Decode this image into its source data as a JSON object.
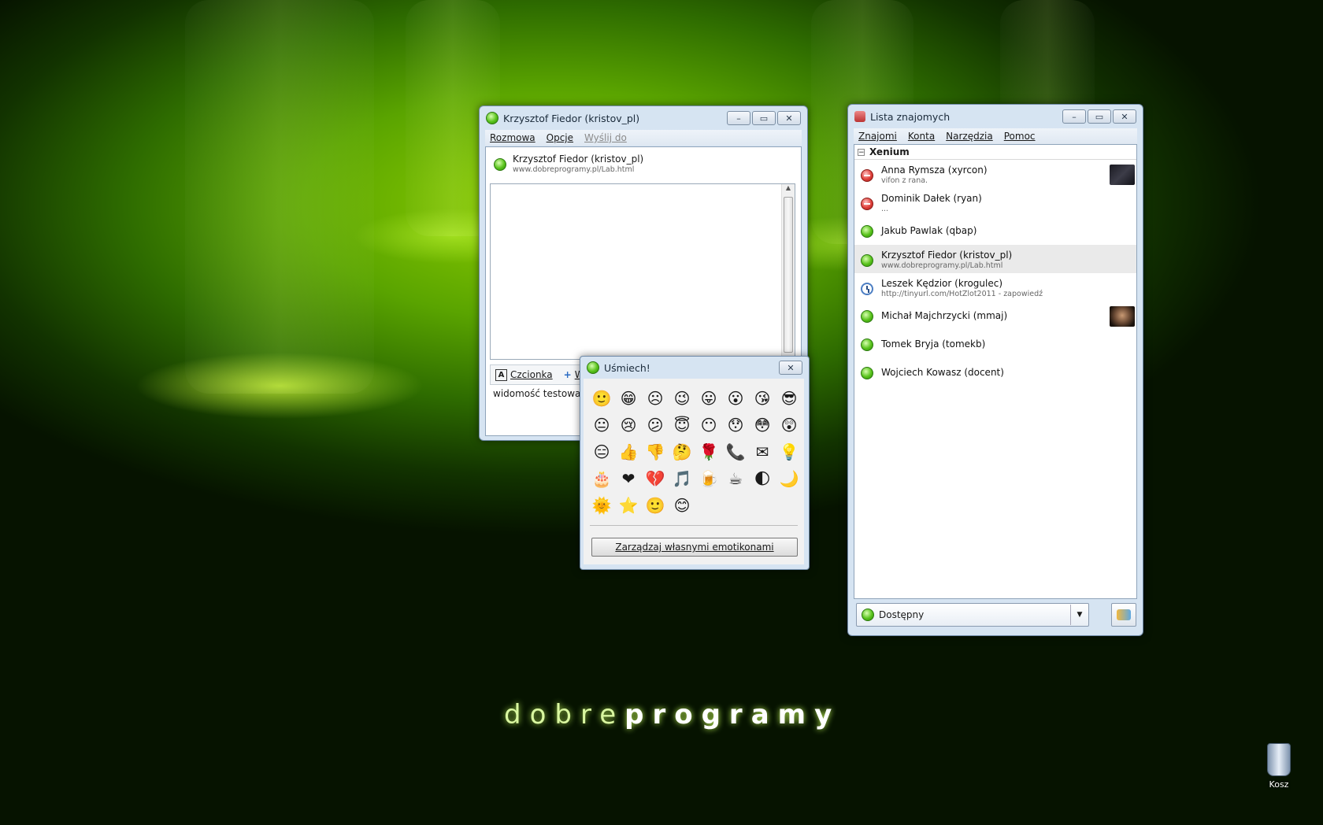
{
  "desktop": {
    "brand_light": "dobre",
    "brand_bold": "programy",
    "trash_label": "Kosz"
  },
  "chat": {
    "title": "Krzysztof Fiedor (kristov_pl)",
    "menu": [
      "Rozmowa",
      "Opcje",
      "Wyślij do"
    ],
    "contact_name": "Krzysztof Fiedor (kristov_pl)",
    "contact_desc": "www.dobreprogramy.pl/Lab.html",
    "font_button": "Czcionka",
    "insert_button": "W",
    "message_input": "widomość testowa :)"
  },
  "emoticons": {
    "title": "Uśmiech!",
    "manage_button": "Zarządzaj własnymi emotikonami",
    "items": [
      "🙂",
      "😁",
      "☹",
      "😉",
      "😛",
      "😮",
      "😘",
      "😎",
      "😐",
      "😢",
      "😕",
      "😇",
      "😶",
      "😯",
      "😳",
      "😲",
      "😑",
      "👍",
      "👎",
      "🤔",
      "🌹",
      "📞",
      "✉",
      "💡",
      "🎂",
      "❤",
      "💔",
      "🎵",
      "🍺",
      "☕",
      "🌓",
      "🌙",
      "🌞",
      "⭐",
      "🙂",
      "😊"
    ]
  },
  "contacts": {
    "title": "Lista znajomych",
    "menu": [
      "Znajomi",
      "Konta",
      "Narzędzia",
      "Pomoc"
    ],
    "group": "Xenium",
    "items": [
      {
        "name": "Anna Rymsza (xyrcon)",
        "desc": "vifon z rana.",
        "status": "red",
        "avatar": "dark"
      },
      {
        "name": "Dominik Dałek (ryan)",
        "desc": "...",
        "status": "red",
        "avatar": ""
      },
      {
        "name": "Jakub Pawlak (qbap)",
        "desc": "",
        "status": "green",
        "avatar": ""
      },
      {
        "name": "Krzysztof Fiedor (kristov_pl)",
        "desc": "www.dobreprogramy.pl/Lab.html",
        "status": "green",
        "avatar": "",
        "selected": true
      },
      {
        "name": "Leszek Kędzior (krogulec)",
        "desc": "http://tinyurl.com/HotZlot2011 - zapowiedź",
        "status": "clock",
        "avatar": ""
      },
      {
        "name": "Michał Majchrzycki (mmaj)",
        "desc": "",
        "status": "green",
        "avatar": "photo"
      },
      {
        "name": "Tomek Bryja (tomekb)",
        "desc": "",
        "status": "green",
        "avatar": ""
      },
      {
        "name": "Wojciech Kowasz (docent)",
        "desc": "",
        "status": "green",
        "avatar": ""
      }
    ],
    "status_value": "Dostępny"
  }
}
